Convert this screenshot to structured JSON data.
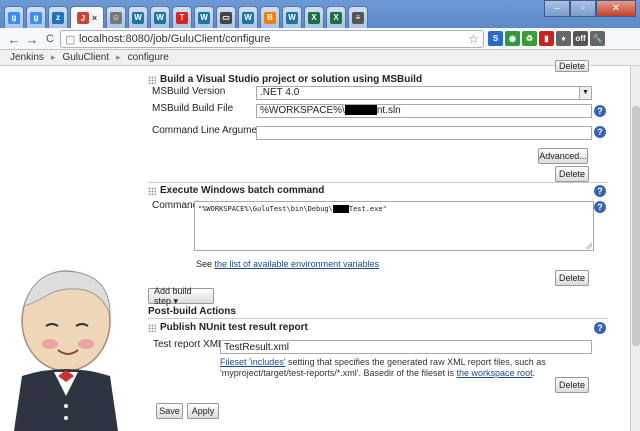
{
  "browser": {
    "tabs": [
      {
        "icon": "google-icon",
        "color": "#3b8fe8",
        "glyph": "g"
      },
      {
        "icon": "google-icon",
        "color": "#3b8fe8",
        "glyph": "g"
      },
      {
        "icon": "zendesk-icon",
        "color": "#1f73b7",
        "glyph": "z"
      },
      {
        "icon": "jenkins-icon",
        "color": "#c43",
        "glyph": "J"
      },
      {
        "icon": "person-icon",
        "color": "#777",
        "glyph": "☺"
      },
      {
        "icon": "wordpress-icon",
        "color": "#21759b",
        "glyph": "W"
      },
      {
        "icon": "wordpress-icon",
        "color": "#21759b",
        "glyph": "W"
      },
      {
        "icon": "t-icon",
        "color": "#d22",
        "glyph": "T"
      },
      {
        "icon": "wordpress-icon",
        "color": "#21759b",
        "glyph": "W"
      },
      {
        "icon": "monitor-icon",
        "color": "#444",
        "glyph": "▭"
      },
      {
        "icon": "wordpress-icon",
        "color": "#21759b",
        "glyph": "W"
      },
      {
        "icon": "blogger-icon",
        "color": "#f57d00",
        "glyph": "B"
      },
      {
        "icon": "wordpress-icon",
        "color": "#21759b",
        "glyph": "W"
      },
      {
        "icon": "excel-icon",
        "color": "#1d7044",
        "glyph": "X"
      },
      {
        "icon": "excel-icon",
        "color": "#1d7044",
        "glyph": "X"
      },
      {
        "icon": "document-icon",
        "color": "#555",
        "glyph": "≡"
      }
    ],
    "active_tab_close": "×",
    "window_buttons": {
      "minimize": "–",
      "maximize": "▫",
      "close": "✕"
    },
    "back": "←",
    "forward": "→",
    "reload": "C",
    "url": "localhost:8080/job/GuluClient/configure",
    "extensions": [
      {
        "name": "s-icon",
        "color": "#2a6ac9",
        "glyph": "S"
      },
      {
        "name": "green-circle-icon",
        "color": "#2e9a3a",
        "glyph": "◉"
      },
      {
        "name": "recycle-icon",
        "color": "#3a9d3a",
        "glyph": "♻"
      },
      {
        "name": "red-book-icon",
        "color": "#c22",
        "glyph": "▮"
      },
      {
        "name": "bulb-icon",
        "color": "#666",
        "glyph": "♦"
      },
      {
        "name": "off-icon",
        "color": "#555",
        "glyph": "off"
      },
      {
        "name": "wrench-icon",
        "color": "#666",
        "glyph": "🔧"
      }
    ]
  },
  "breadcrumb": [
    "Jenkins",
    "GuluClient",
    "configure"
  ],
  "msbuild": {
    "title": "Build a Visual Studio project or solution using MSBuild",
    "version_label": "MSBuild Version",
    "version_value": ".NET 4.0",
    "file_label": "MSBuild Build File",
    "file_prefix": "%WORKSPACE%\\",
    "file_suffix": "nt.sln",
    "args_label": "Command Line Arguments",
    "args_value": "",
    "advanced": "Advanced...",
    "delete": "Delete"
  },
  "batch": {
    "title": "Execute Windows batch command",
    "command_label": "Command",
    "command_prefix": "\"%WORKSPACE%\\GuluTest\\bin\\Debug\\",
    "command_suffix": "Test.exe\"",
    "see_prefix": "See ",
    "see_link": "the list of available environment variables",
    "delete": "Delete"
  },
  "add_build_step": "Add build step ▾",
  "post_build": {
    "heading": "Post-build Actions",
    "title": "Publish NUnit test result report",
    "xml_label": "Test report XMLs",
    "xml_value": "TestResult.xml",
    "desc_link1": "Fileset 'includes'",
    "desc_text1": " setting that specifies the generated raw XML report files, such as",
    "desc_text2": "'myproject/target/test-reports/*.xml'. Basedir of the fileset is ",
    "desc_link2": "the workspace root",
    "desc_end": ".",
    "delete": "Delete"
  },
  "top_delete": "Delete",
  "save": "Save",
  "apply": "Apply",
  "help_glyph": "?"
}
